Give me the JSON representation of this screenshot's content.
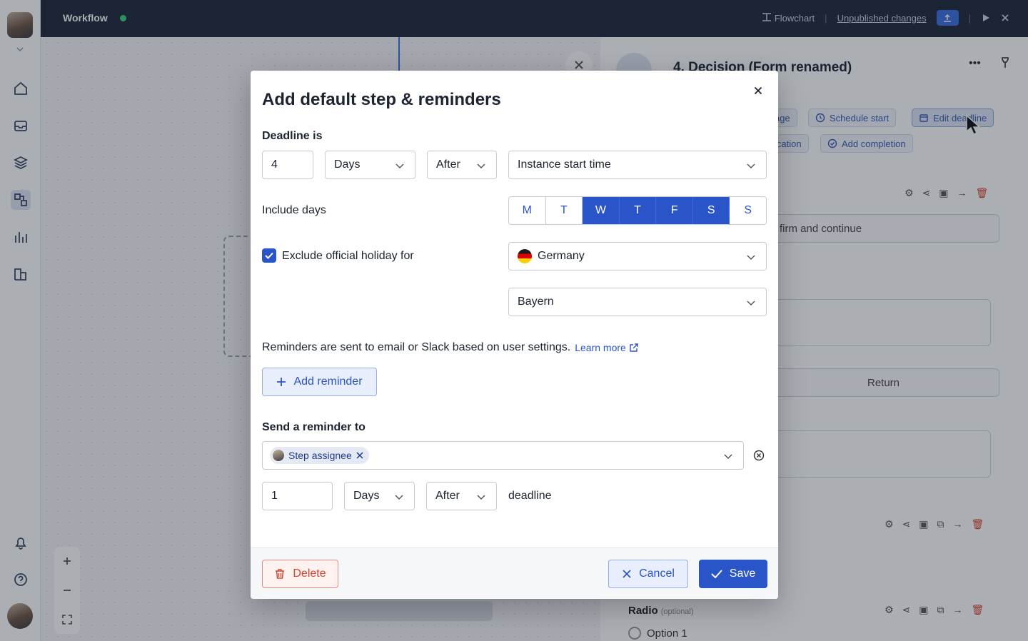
{
  "app": {
    "title": "Workflow",
    "topbar": {
      "flowchart_label": "Flowchart",
      "unpublished_label": "Unpublished changes"
    }
  },
  "panel": {
    "title": "4. Decision (Form renamed)",
    "buttons": [
      "age",
      "Schedule start",
      "Edit deadline",
      "ication",
      "Add completion"
    ],
    "fields": {
      "confirm": "firm and continue",
      "return": "Return"
    },
    "radio_label": "Radio",
    "radio_optional": "(optional)",
    "radio_option": "Option 1"
  },
  "modal": {
    "title": "Add default step & reminders",
    "deadline": {
      "label": "Deadline is",
      "amount": "4",
      "unit": "Days",
      "relation": "After",
      "anchor": "Instance start time"
    },
    "include_days": {
      "label": "Include days",
      "days": [
        {
          "label": "M",
          "on": false
        },
        {
          "label": "T",
          "on": false
        },
        {
          "label": "W",
          "on": true
        },
        {
          "label": "T",
          "on": true
        },
        {
          "label": "F",
          "on": true
        },
        {
          "label": "S",
          "on": true
        },
        {
          "label": "S",
          "on": false
        }
      ]
    },
    "holiday": {
      "label": "Exclude official holiday for",
      "checked": true,
      "country": "Germany",
      "region": "Bayern"
    },
    "reminders": {
      "info": "Reminders are sent to email or Slack based on user settings.",
      "learn_more": "Learn more",
      "add_label": "Add reminder"
    },
    "send_reminder": {
      "label": "Send a reminder to",
      "recipient_chip": "Step assignee",
      "amount": "1",
      "unit": "Days",
      "relation": "After",
      "suffix": "deadline"
    },
    "footer": {
      "delete_label": "Delete",
      "cancel_label": "Cancel",
      "save_label": "Save"
    }
  },
  "colors": {
    "accent": "#2a55c9",
    "danger": "#d9412e",
    "topbar": "#1f2a3b"
  }
}
